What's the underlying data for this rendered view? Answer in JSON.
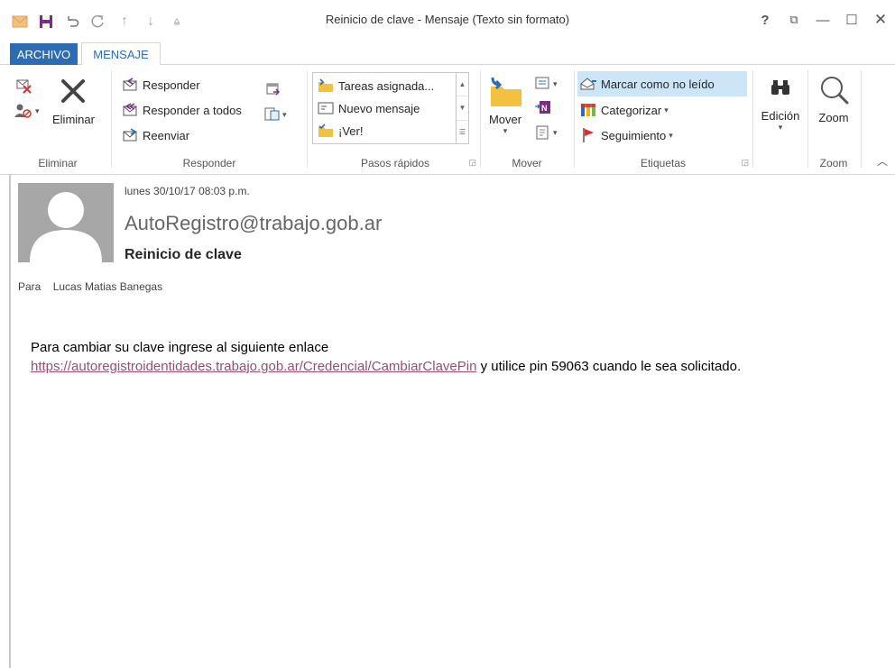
{
  "window": {
    "title": "Reinicio de clave - Mensaje (Texto sin formato)",
    "help": "?",
    "controls": [
      "⧉",
      "—",
      "☐",
      "✕"
    ]
  },
  "qat": [
    "mail-icon",
    "save-icon",
    "undo-icon",
    "redo-icon",
    "up-icon",
    "down-icon",
    "customize-icon"
  ],
  "tabs": {
    "file": "ARCHIVO",
    "message": "MENSAJE"
  },
  "ribbon": {
    "eliminar": {
      "delete_label": "Eliminar",
      "group_label": "Eliminar"
    },
    "responder": {
      "reply": "Responder",
      "reply_all": "Responder a todos",
      "forward": "Reenviar",
      "group_label": "Responder"
    },
    "quick_steps": {
      "items": [
        "Tareas asignada...",
        "Nuevo mensaje",
        "¡Ver!"
      ],
      "group_label": "Pasos rápidos"
    },
    "mover": {
      "move_label": "Mover",
      "group_label": "Mover"
    },
    "etiquetas": {
      "mark_unread": "Marcar como no leído",
      "categorize": "Categorizar",
      "followup": "Seguimiento",
      "group_label": "Etiquetas"
    },
    "edicion": {
      "label": "Edición"
    },
    "zoom": {
      "label": "Zoom",
      "group_label": "Zoom"
    },
    "colors": {
      "accent": "#2b6cb5",
      "flag": "#d7312a",
      "highlight": "#cde6f7"
    }
  },
  "message": {
    "date": "lunes 30/10/17 08:03 p.m.",
    "sender": "AutoRegistro@trabajo.gob.ar",
    "subject": "Reinicio de clave",
    "to_label": "Para",
    "to_name": "Lucas Matias Banegas",
    "body_line1": "Para cambiar su clave ingrese al siguiente enlace",
    "link": "https://autoregistroidentidades.trabajo.gob.ar/Credencial/CambiarClavePin",
    "body_line2_rest": " y utilice pin 59063 cuando le sea solicitado."
  }
}
